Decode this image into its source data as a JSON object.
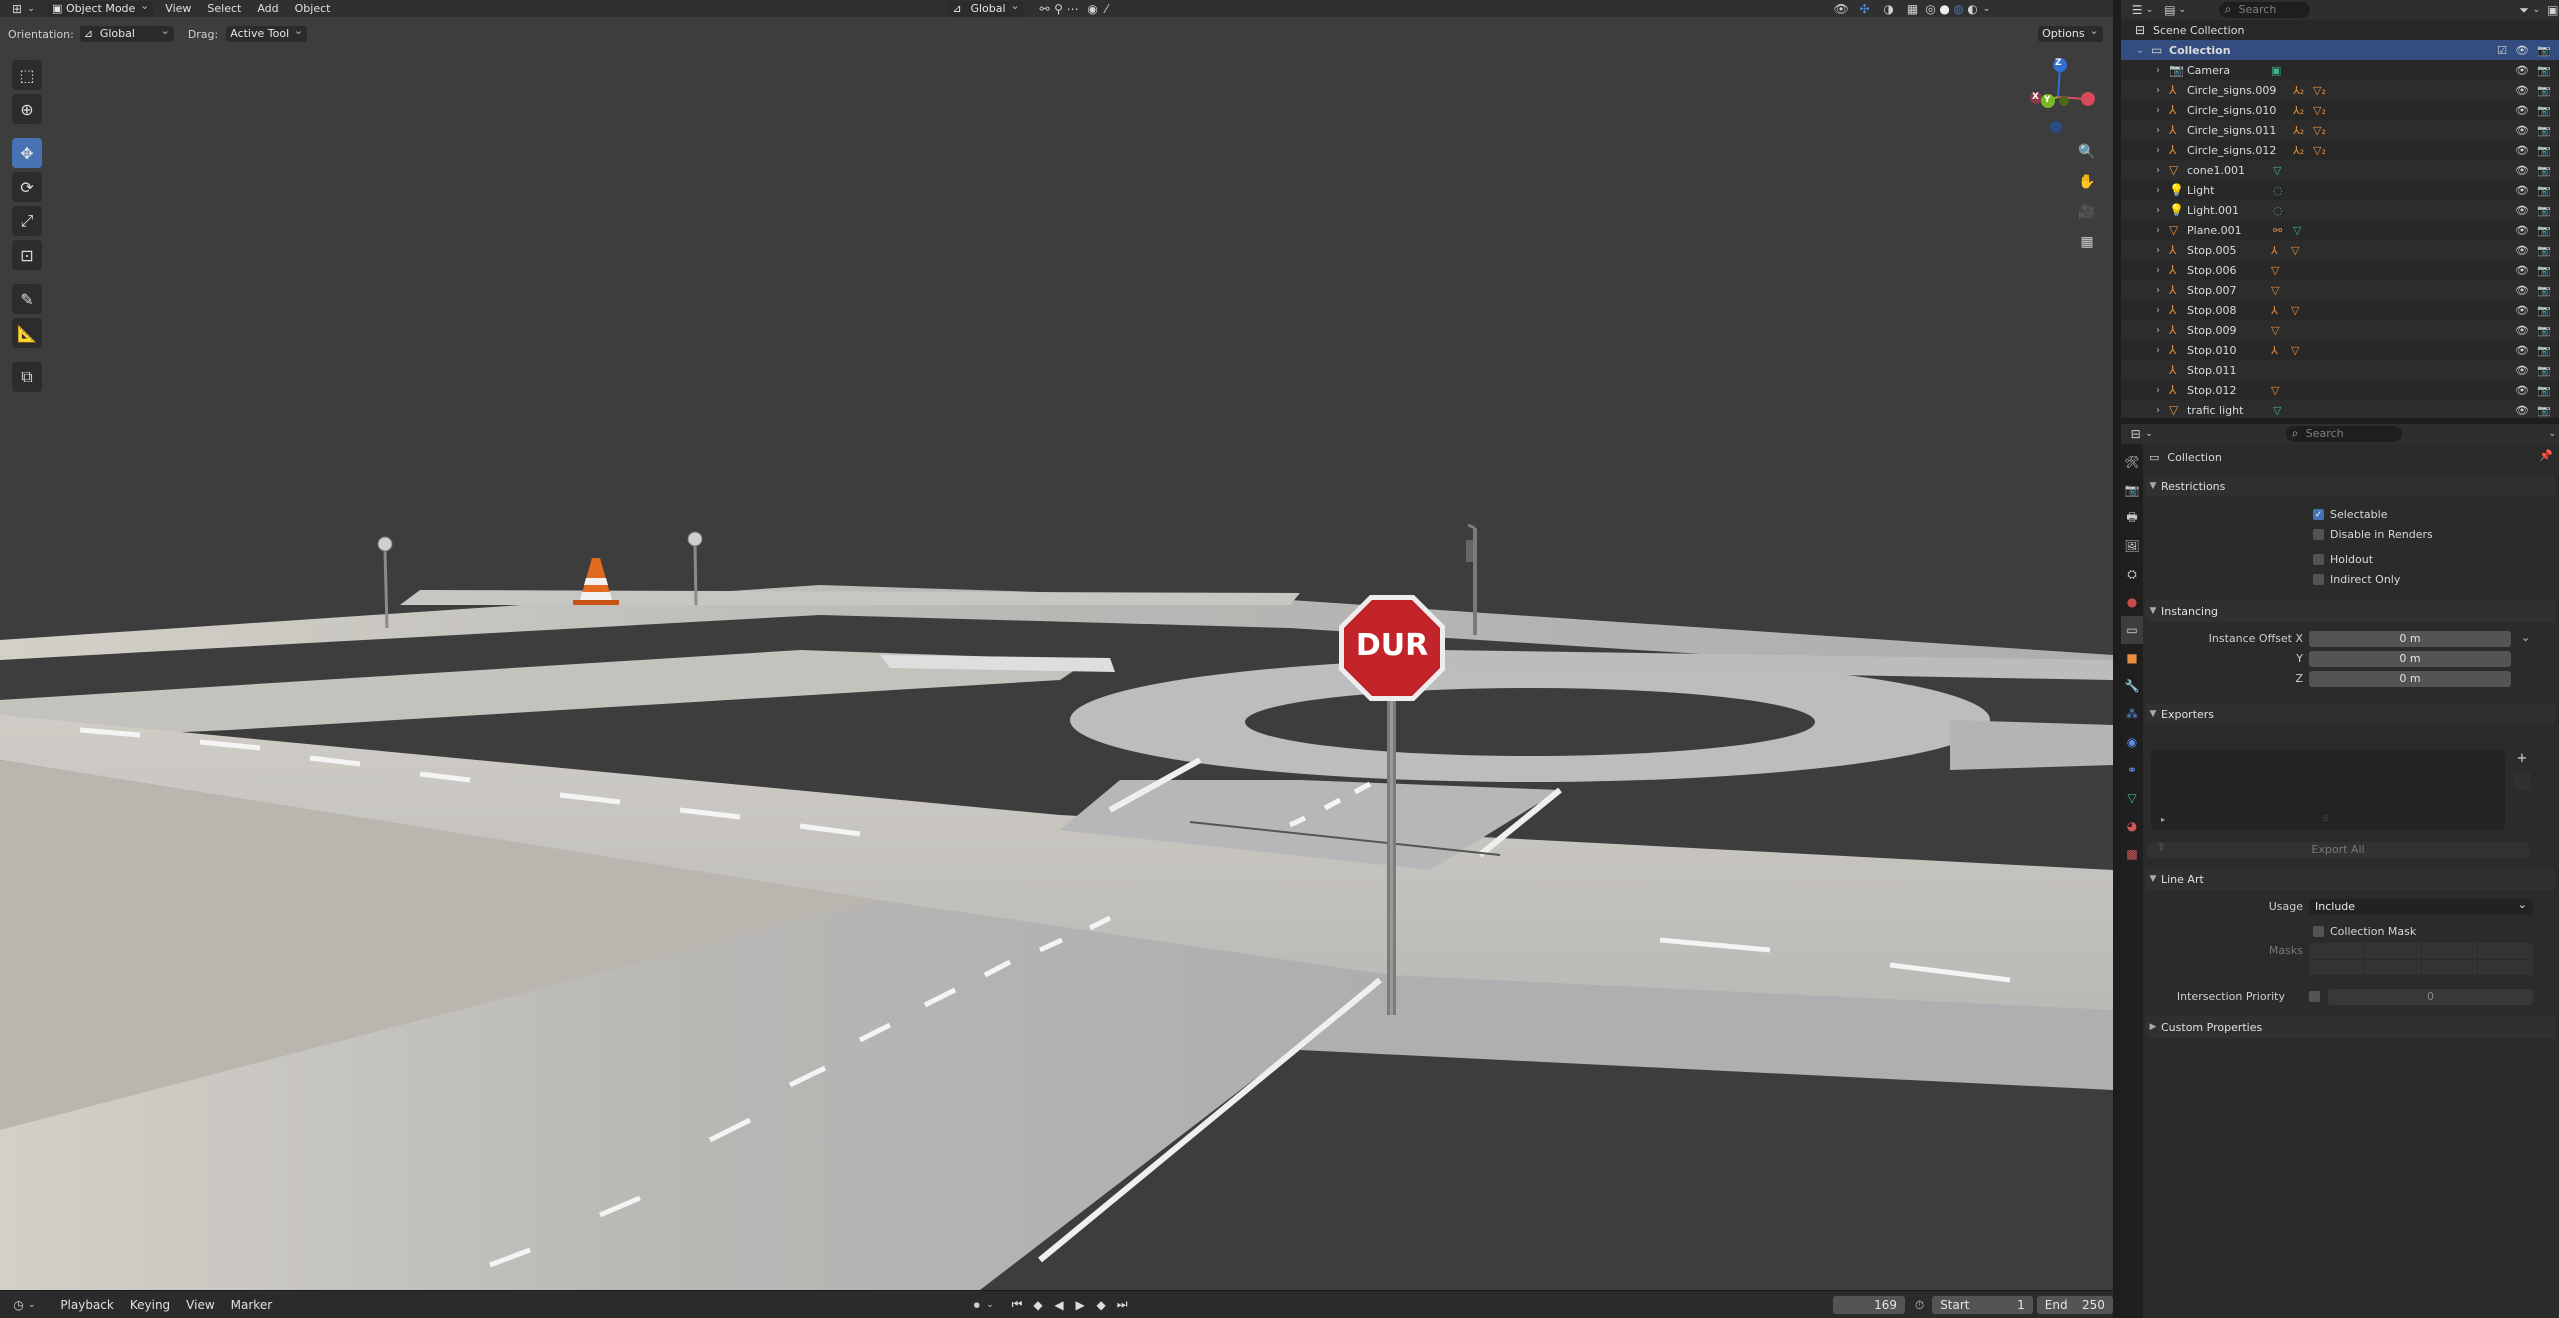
{
  "viewport_header": {
    "mode": "Object Mode",
    "menus": [
      "View",
      "Select",
      "Add",
      "Object"
    ],
    "transform_orientation": "Global"
  },
  "tool_header": {
    "orientation_label": "Orientation:",
    "orientation_value": "Global",
    "drag_label": "Drag:",
    "drag_value": "Active Tool",
    "options": "Options"
  },
  "gizmo": {
    "x": "X",
    "y": "Y",
    "z": "Z"
  },
  "scene": {
    "sign_text": "DUR"
  },
  "timeline": {
    "menus": [
      "Playback",
      "Keying",
      "View",
      "Marker"
    ],
    "current_frame": "169",
    "start_label": "Start",
    "start_value": "1",
    "end_label": "End",
    "end_value": "250"
  },
  "outliner": {
    "search_placeholder": "Search",
    "scene_collection": "Scene Collection",
    "collection": "Collection",
    "items": [
      {
        "name": "Camera"
      },
      {
        "name": "Circle_signs.009"
      },
      {
        "name": "Circle_signs.010"
      },
      {
        "name": "Circle_signs.011"
      },
      {
        "name": "Circle_signs.012"
      },
      {
        "name": "cone1.001"
      },
      {
        "name": "Light"
      },
      {
        "name": "Light.001"
      },
      {
        "name": "Plane.001"
      },
      {
        "name": "Stop.005"
      },
      {
        "name": "Stop.006"
      },
      {
        "name": "Stop.007"
      },
      {
        "name": "Stop.008"
      },
      {
        "name": "Stop.009"
      },
      {
        "name": "Stop.010"
      },
      {
        "name": "Stop.011"
      },
      {
        "name": "Stop.012"
      },
      {
        "name": "trafic light"
      }
    ]
  },
  "properties": {
    "search_placeholder": "Search",
    "context_title": "Collection",
    "restrictions": {
      "title": "Restrictions",
      "selectable": "Selectable",
      "disable_in_renders": "Disable in Renders",
      "holdout": "Holdout",
      "indirect_only": "Indirect Only"
    },
    "instancing": {
      "title": "Instancing",
      "offset_x_label": "Instance Offset X",
      "y_label": "Y",
      "z_label": "Z",
      "x_value": "0 m",
      "y_value": "0 m",
      "z_value": "0 m"
    },
    "exporters": {
      "title": "Exporters",
      "export_all": "Export All"
    },
    "line_art": {
      "title": "Line Art",
      "usage_label": "Usage",
      "usage_value": "Include",
      "collection_mask": "Collection Mask",
      "masks_label": "Masks",
      "intersection_priority_label": "Intersection Priority",
      "intersection_priority_value": "0"
    },
    "custom_properties": {
      "title": "Custom Properties"
    }
  }
}
